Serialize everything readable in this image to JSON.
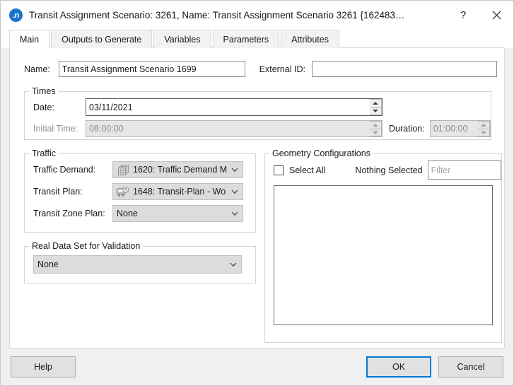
{
  "window": {
    "title": "Transit Assignment Scenario: 3261, Name: Transit Assignment  Scenario 3261 {162483…",
    "app_icon_text": ".n",
    "help_glyph": "?",
    "close_glyph": "✕"
  },
  "tabs": [
    {
      "label": "Main",
      "active": true
    },
    {
      "label": "Outputs to Generate",
      "active": false
    },
    {
      "label": "Variables",
      "active": false
    },
    {
      "label": "Parameters",
      "active": false
    },
    {
      "label": "Attributes",
      "active": false
    }
  ],
  "main": {
    "name_label": "Name:",
    "name_value": "Transit Assignment Scenario 1699",
    "external_id_label": "External ID:",
    "external_id_value": "",
    "times": {
      "legend": "Times",
      "date_label": "Date:",
      "date_value": "03/11/2021",
      "initial_time_label": "Initial Time:",
      "initial_time_value": "08:00:00",
      "duration_label": "Duration:",
      "duration_value": "01:00:00"
    },
    "traffic": {
      "legend": "Traffic",
      "traffic_demand_label": "Traffic Demand:",
      "traffic_demand_value": "1620: Traffic Demand M",
      "traffic_demand_icon": "matrix-stack-icon",
      "transit_plan_label": "Transit Plan:",
      "transit_plan_value": "1648: Transit-Plan - Wo",
      "transit_plan_icon": "bus-clock-icon",
      "transit_zone_plan_label": "Transit Zone Plan:",
      "transit_zone_plan_value": "None"
    },
    "real_data_set": {
      "legend": "Real Data Set for Validation",
      "value": "None"
    },
    "geometry": {
      "legend": "Geometry Configurations",
      "select_all_label": "Select All",
      "select_all_checked": false,
      "selection_status": "Nothing Selected",
      "filter_placeholder": "Filter",
      "filter_value": "",
      "items": []
    }
  },
  "footer": {
    "help_label": "Help",
    "ok_label": "OK",
    "cancel_label": "Cancel"
  },
  "colors": {
    "accent": "#0078d7",
    "icon_blue": "#1a73c8",
    "dialog_bg": "#f0f0f0",
    "panel_bg": "#ffffff",
    "combo_bg": "#dcdcdc",
    "disabled_bg": "#e6e6e6"
  }
}
